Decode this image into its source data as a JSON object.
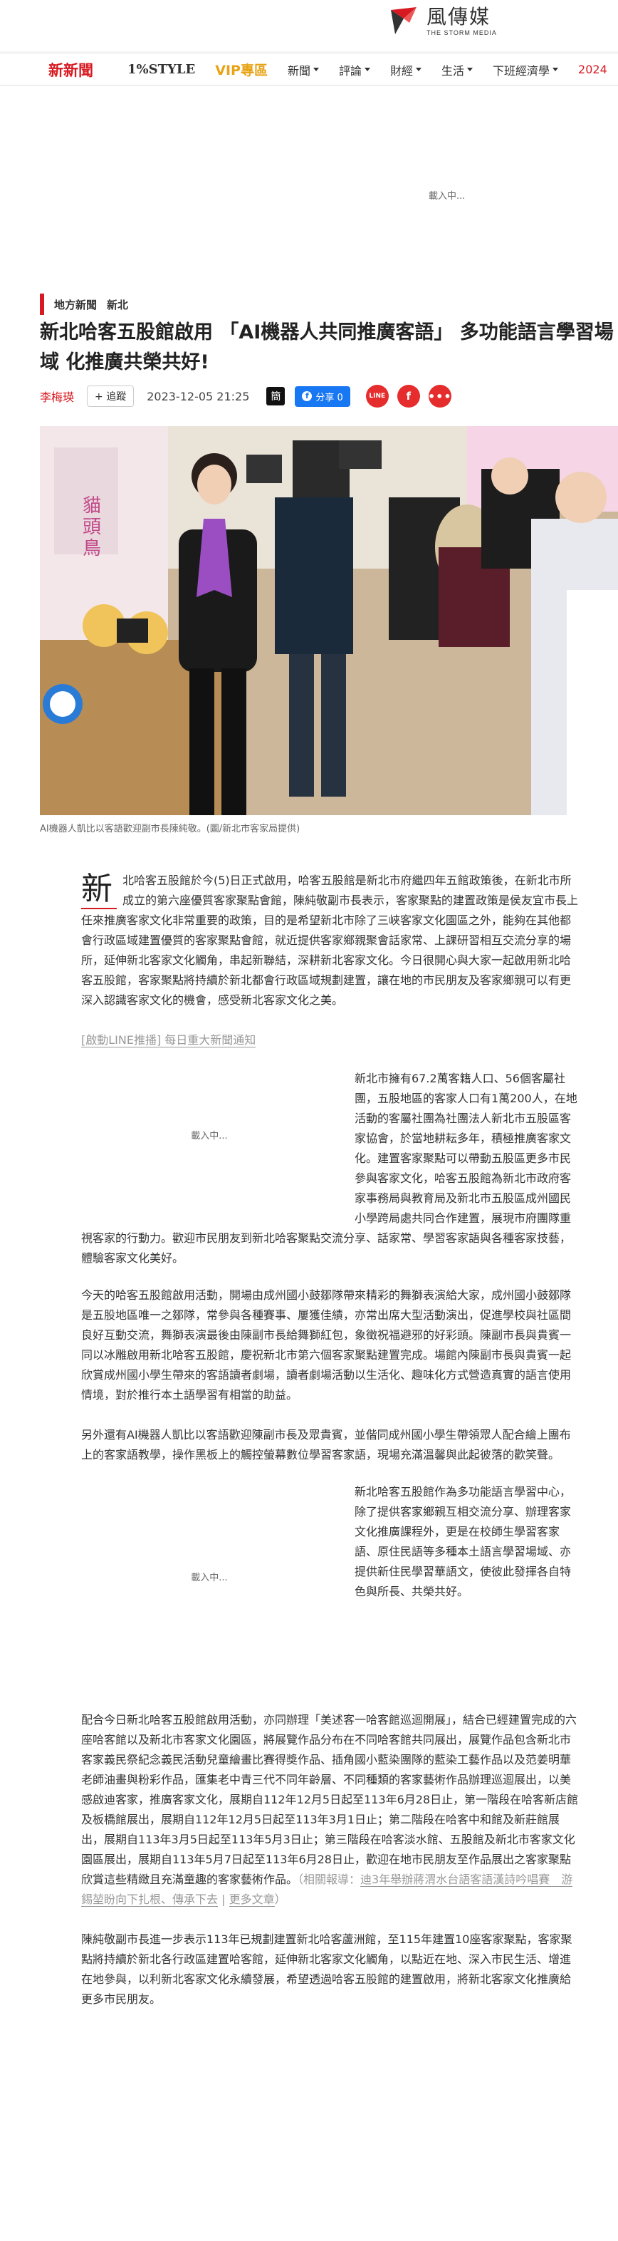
{
  "header": {
    "logo_cn": "風傳媒",
    "logo_en": "THE STORM MEDIA"
  },
  "nav": {
    "brand": "新新聞",
    "style": "1%STYLE",
    "vip": "VIP專區",
    "items": [
      "新聞",
      "評論",
      "財經",
      "生活",
      "下班經濟學"
    ],
    "year": "2024"
  },
  "ad_top": {
    "loading": "載入中..."
  },
  "article": {
    "categories": [
      "地方新聞",
      "新北"
    ],
    "title": "新北哈客五股館啟用 「AI機器人共同推廣客語」 多功能語言學習場域 化推廣共榮共好!",
    "author": "李梅瑛",
    "follow": "+ 追蹤",
    "date": "2023-12-05 21:25",
    "share_cn": "簡",
    "fb_share": "分享 0",
    "line": "LINE",
    "caption": "AI機器人凱比以客語歡迎副市長陳純敬。(圖/新北市客家局提供)",
    "dropcap": "新",
    "p1": "北哈客五股館於今(5)日正式啟用，哈客五股館是新北市府繼四年五館政策後，在新北市所成立的第六座優質客家聚點會館，陳純敬副市長表示，客家聚點的建置政策是侯友宜市長上任來推廣客家文化非常重要的政策，目的是希望新北市除了三峽客家文化園區之外，能夠在其他都會行政區域建置優質的客家聚點會館，就近提供客家鄉親聚會話家常、上課研習相互交流分享的場所，延伸新北客家文化觸角，串起新聯結，深耕新北客家文化。今日很開心與大家一起啟用新北哈客五股館，客家聚點將持續於新北都會行政區域規劃建置，讓在地的市民朋友及客家鄉親可以有更深入認識客家文化的機會，感受新北客家文化之美。",
    "line_push": "[啟動LINE推播] 每日重大新聞通知",
    "inline_loading": "載入中...",
    "p2": "新北市擁有67.2萬客籍人口、56個客屬社團，五股地區的客家人口有1萬200人，在地活動的客屬社團為社團法人新北市五股區客家協會，於當地耕耘多年，積極推廣客家文化。建置客家聚點可以帶動五股區更多市民參與客家文化，哈客五股館為新北市政府客家事務局與教育局及新北市五股區成州國民小學跨局處共同合作建置，展現市府團隊重視客家的行動力。歡迎市民朋友到新北哈客聚點交流分享、話家常、學習客家語與各種客家技藝，體驗客家文化美好。",
    "p3": "今天的哈客五股館啟用活動，開場由成州國小鼓鄒隊帶來精彩的舞獅表演給大家，成州國小鼓鄒隊是五股地區唯一之鄒隊，常參與各種賽事、屢獲佳績，亦常出席大型活動演出，促進學校與社區間良好互動交流，舞獅表演最後由陳副市長給舞獅紅包，象徵祝福避邪的好彩頭。陳副市長與貴賓一同以冰雕啟用新北哈客五股館，慶祝新北市第六個客家聚點建置完成。場館內陳副市長與貴賓一起欣賞成州國小學生帶來的客語讀者劇場，讀者劇場活動以生活化、趣味化方式營造真實的語言使用情境，對於推行本土語學習有相當的助益。",
    "p4": "另外還有AI機器人凱比以客語歡迎陳副市長及眾貴賓，並偕同成州國小學生帶領眾人配合繪上團布上的客家語教學，操作黑板上的觸控螢幕數位學習客家語，現場充滿溫馨與此起彼落的歡笑聲。",
    "p5": "新北哈客五股館作為多功能語言學習中心，除了提供客家鄉親互相交流分享、辦理客家文化推廣課程外，更是在校師生學習客家語、原住民語等多種本土語言學習場域、亦提供新住民學習華語文，使彼此發揮各自特色與所長、共榮共好。",
    "p6": "配合今日新北哈客五股館啟用活動，亦同辦理「美述客一哈客館巡迴開展」，結合已經建置完成的六座哈客館以及新北市客家文化園區，將展覽作品分布在不同哈客館共同展出，展覽作品包含新北市客家義民祭紀念義民活動兒童繪畫比賽得獎作品、插角國小藍染團隊的藍染工藝作品以及范姜明華老師油畫與粉彩作品，匯集老中青三代不同年齡層、不同種類的客家藝術作品辦理巡迴展出，以美感啟迪客家，推廣客家文化，展期自112年12月5日起至113年6月28日止，第一階段在哈客新店館及板橋館展出，展期自112年12月5日起至113年3月1日止；第二階段在哈客中和館及新莊館展出，展期自113年3月5日起至113年5月3日止；第三階段在哈客淡水館、五股館及新北市客家文化園區展出，展期自113年5月7日起至113年6月28日止，歡迎在地市民朋友至作品展出之客家聚點欣賞這些精緻且充滿童趣的客家藝術作品。",
    "related_prefix": "（相關報導：",
    "related_link": "迪3年舉辦蔣渭水台語客語漢詩吟唱賽　游錫堃盼向下扎根、傳承下去",
    "related_more": "更多文章",
    "related_suffix": "）",
    "p7": "陳純敬副市長進一步表示113年已規劃建置新北哈客蘆洲館，至115年建置10座客家聚點，客家聚點將持續於新北各行政區建置哈客館，延伸新北客家文化觸角，以點近在地、深入市民生活、增進在地參與，以利新北客家文化永續發展，希望透過哈客五股館的建置啟用，將新北客家文化推廣給更多市民朋友。"
  }
}
